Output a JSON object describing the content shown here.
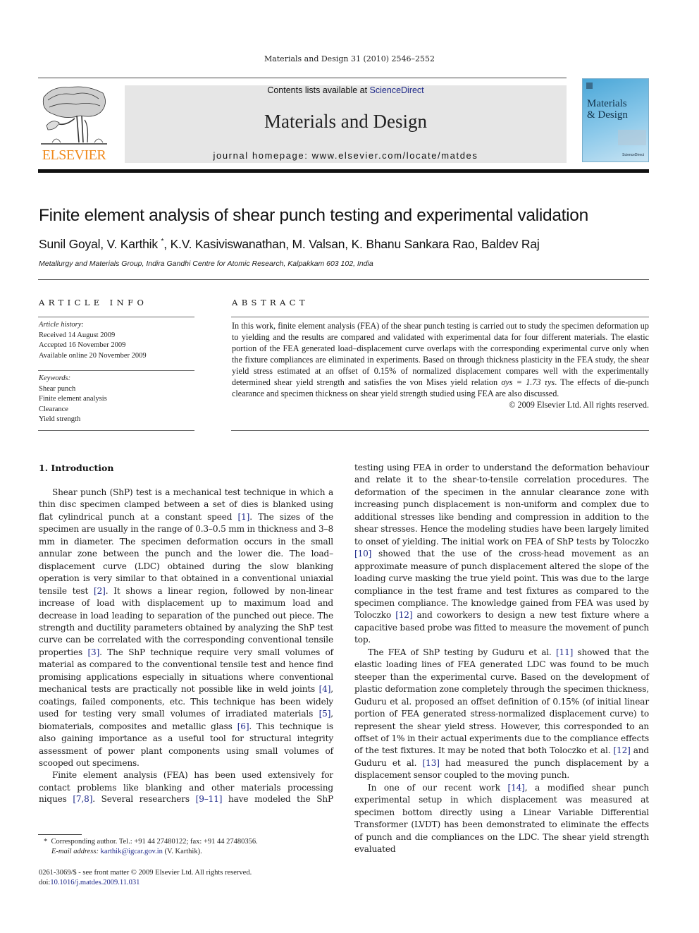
{
  "running_head": "Materials and Design 31 (2010) 2546–2552",
  "masthead": {
    "contents_prefix": "Contents lists available at ",
    "contents_link": "ScienceDirect",
    "journal_name": "Materials and Design",
    "homepage": "journal homepage: www.elsevier.com/locate/matdes",
    "publisher_logo_text": "ELSEVIER",
    "cover_title_line1": "Materials",
    "cover_title_line2": "& Design",
    "cover_footer": "ScienceDirect"
  },
  "colors": {
    "elsevier_orange": "#f08a1c",
    "link_blue": "#1f2a8a",
    "masthead_gray": "#e6e6e6"
  },
  "article": {
    "title": "Finite element analysis of shear punch testing and experimental validation",
    "authors_before": "Sunil Goyal, V. Karthik ",
    "author_mark": "*",
    "authors_after": ", K.V. Kasiviswanathan, M. Valsan, K. Bhanu Sankara Rao, Baldev Raj",
    "affiliation": "Metallurgy and Materials Group, Indira Gandhi Centre for Atomic Research, Kalpakkam 603 102, India"
  },
  "article_info": {
    "heading": "ARTICLE INFO",
    "history_label": "Article history:",
    "history": [
      "Received 14 August 2009",
      "Accepted 16 November 2009",
      "Available online 20 November 2009"
    ],
    "keywords_label": "Keywords:",
    "keywords": [
      "Shear punch",
      "Finite element analysis",
      "Clearance",
      "Yield strength"
    ]
  },
  "abstract": {
    "heading": "ABSTRACT",
    "text_part1": "In this work, finite element analysis (FEA) of the shear punch testing is carried out to study the specimen deformation up to yielding and the results are compared and validated with experimental data for four different materials. The elastic portion of the FEA generated load–displacement curve overlaps with the corresponding experimental curve only when the fixture compliances are eliminated in experiments. Based on through thickness plasticity in the FEA study, the shear yield stress estimated at an offset of 0.15% of normalized displacement compares well with the experimentally determined shear yield strength and satisfies the von Mises yield relation ",
    "equation": "σys = 1.73 τys",
    "text_part2": ". The effects of die-punch clearance and specimen thickness on shear yield strength studied using FEA are also discussed.",
    "copyright": "© 2009 Elsevier Ltd. All rights reserved."
  },
  "section": {
    "heading": "1. Introduction"
  },
  "body": {
    "p1": [
      "Shear punch (ShP) test is a mechanical test technique in which a thin disc specimen clamped between a set of dies is blanked using flat cylindrical punch at a constant speed ",
      "[1]",
      ". The sizes of the specimen are usually in the range of 0.3–0.5 mm in thickness and 3–8 mm in diameter. The specimen deformation occurs in the small annular zone between the punch and the lower die. The load–displacement curve (LDC) obtained during the slow blanking operation is very similar to that obtained in a conventional uniaxial tensile test ",
      "[2]",
      ". It shows a linear region, followed by non-linear increase of load with displacement up to maximum load and decrease in load leading to separation of the punched out piece. The strength and ductility parameters obtained by analyzing the ShP test curve can be correlated with the corresponding conventional tensile properties ",
      "[3]",
      ". The ShP technique require very small volumes of material as compared to the conventional tensile test and hence find promising applications especially in situations where conventional mechanical tests are practically not possible like in weld joints ",
      "[4]",
      ", coatings, failed components, etc. This technique has been widely used for testing very small volumes of irradiated materials ",
      "[5]",
      ", biomaterials, composites and metallic glass ",
      "[6]",
      ". This technique is also gaining importance as a useful tool for structural integrity assessment of power plant components using small volumes of scooped out specimens."
    ],
    "p2": [
      "Finite element analysis (FEA) has been used extensively for contact problems like blanking and other materials processing techniques ",
      "[7,8]",
      ". Several researchers ",
      "[9–11]",
      " have modeled the ShP testing using FEA in order to understand the deformation behaviour and relate it to the shear-to-tensile correlation procedures. The deformation of the specimen in the annular clearance zone with increasing punch displacement is non-uniform and complex due to additional stresses like bending and compression in addition to the shear stresses. Hence the modeling studies have been largely limited to onset of yielding. The initial work on FEA of ShP tests by Toloczko ",
      "[10]",
      " showed that the use of the cross-head movement as an approximate measure of punch displacement altered the slope of the loading curve masking the true yield point. This was due to the large compliance in the test frame and test fixtures as compared to the specimen compliance. The knowledge gained from FEA was used by Toloczko ",
      "[12]",
      " and coworkers to design a new test fixture where a capacitive based probe was fitted to measure the movement of punch top."
    ],
    "p3": [
      "The FEA of ShP testing by Guduru et al. ",
      "[11]",
      " showed that the elastic loading lines of FEA generated LDC was found to be much steeper than the experimental curve. Based on the development of plastic deformation zone completely through the specimen thickness, Guduru et al. proposed an offset definition of 0.15% (of initial linear portion of FEA generated stress-normalized displacement curve) to represent the shear yield stress. However, this corresponded to an offset of 1% in their actual experiments due to the compliance effects of the test fixtures. It may be noted that both Toloczko et al. ",
      "[12]",
      " and Guduru et al. ",
      "[13]",
      " had measured the punch displacement by a displacement sensor coupled to the moving punch."
    ],
    "p4": [
      "In one of our recent work ",
      "[14]",
      ", a modified shear punch experimental setup in which displacement was measured at specimen bottom directly using a Linear Variable Differential Transformer (LVDT) has been demonstrated to eliminate the effects of punch and die compliances on the LDC. The shear yield strength evaluated"
    ]
  },
  "footnotes": {
    "mark": "*",
    "corresponding": "Corresponding author. Tel.: +91 44 27480122; fax: +91 44 27480356.",
    "email_label": "E-mail address:",
    "email": "karthik@igcar.gov.in",
    "email_suffix": " (V. Karthik).",
    "front_matter": "0261-3069/$ - see front matter © 2009 Elsevier Ltd. All rights reserved.",
    "doi_prefix": "doi:",
    "doi": "10.1016/j.matdes.2009.11.031"
  }
}
